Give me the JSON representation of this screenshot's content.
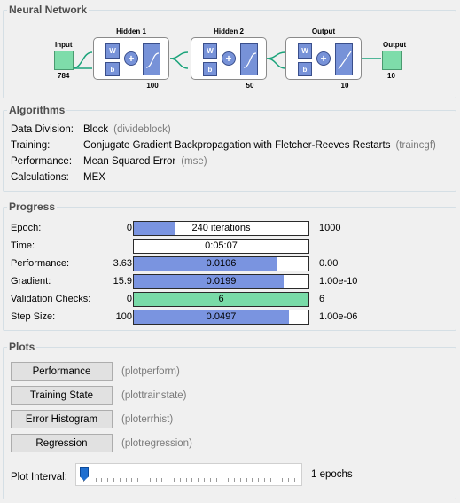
{
  "network": {
    "title": "Neural Network",
    "input": {
      "label": "Input",
      "size": "784"
    },
    "layers": [
      {
        "name": "Hidden 1",
        "size": "100",
        "transfer": "sigmoid"
      },
      {
        "name": "Hidden 2",
        "size": "50",
        "transfer": "sigmoid"
      },
      {
        "name": "Output",
        "size": "10",
        "transfer": "softmax"
      }
    ],
    "weight_label": "W",
    "bias_label": "b",
    "output": {
      "label": "Output",
      "size": "10"
    },
    "colors": {
      "io": "#7edcaa",
      "block": "#7792d8",
      "link": "#1aa37a"
    }
  },
  "algorithms": {
    "title": "Algorithms",
    "rows": [
      {
        "key": "Data Division:",
        "value": "Block",
        "code": "(divideblock)"
      },
      {
        "key": "Training:",
        "value": "Conjugate Gradient Backpropagation with Fletcher-Reeves Restarts",
        "code": "(traincgf)"
      },
      {
        "key": "Performance:",
        "value": "Mean Squared Error",
        "code": "(mse)"
      },
      {
        "key": "Calculations:",
        "value": "MEX",
        "code": ""
      }
    ]
  },
  "progress": {
    "title": "Progress",
    "rows": [
      {
        "key": "Epoch:",
        "low": "0",
        "text": "240 iterations",
        "high": "1000",
        "fill": 0.24,
        "color": "blue"
      },
      {
        "key": "Time:",
        "low": "",
        "text": "0:05:07",
        "high": "",
        "fill": 0,
        "color": "blue"
      },
      {
        "key": "Performance:",
        "low": "3.63",
        "text": "0.0106",
        "high": "0.00",
        "fill": 0.82,
        "color": "blue"
      },
      {
        "key": "Gradient:",
        "low": "15.9",
        "text": "0.0199",
        "high": "1.00e-10",
        "fill": 0.86,
        "color": "blue"
      },
      {
        "key": "Validation Checks:",
        "low": "0",
        "text": "6",
        "high": "6",
        "fill": 1.0,
        "color": "green"
      },
      {
        "key": "Step Size:",
        "low": "100",
        "text": "0.0497",
        "high": "1.00e-06",
        "fill": 0.89,
        "color": "blue"
      }
    ]
  },
  "plots": {
    "title": "Plots",
    "buttons": [
      {
        "label": "Performance",
        "cmd": "(plotperform)"
      },
      {
        "label": "Training State",
        "cmd": "(plottrainstate)"
      },
      {
        "label": "Error Histogram",
        "cmd": "(ploterrhist)"
      },
      {
        "label": "Regression",
        "cmd": "(plotregression)"
      }
    ],
    "interval_label": "Plot Interval:",
    "interval_value": "1 epochs",
    "interval_fraction": 0.0
  }
}
